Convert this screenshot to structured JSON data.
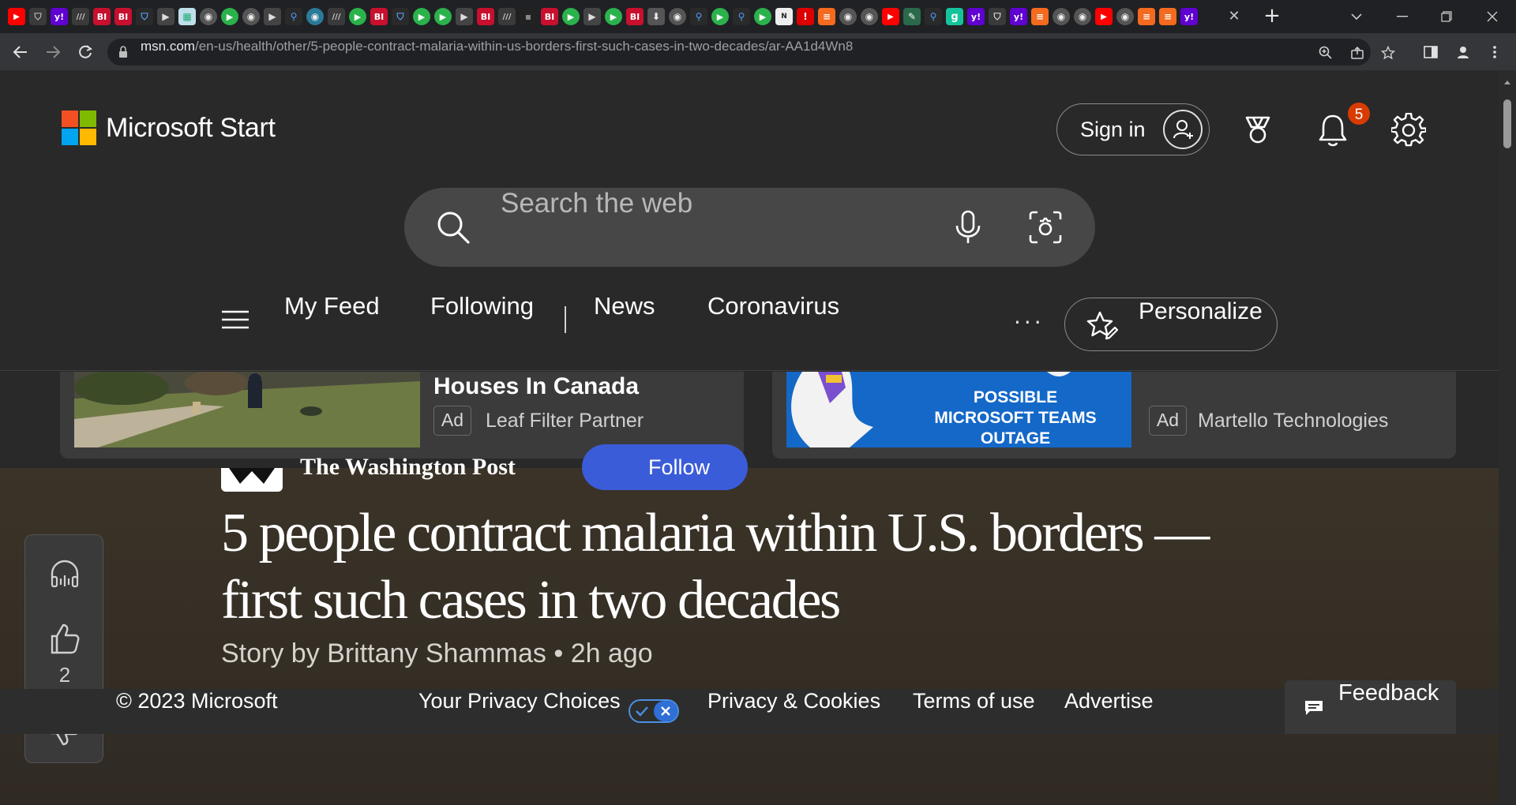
{
  "browser": {
    "url_host": "msn.com",
    "url_path": "/en-us/health/other/5-people-contract-malaria-within-us-borders-first-such-cases-in-two-decades/ar-AA1d4Wn8",
    "tab_close_glyph": "✕",
    "new_tab_glyph": "+"
  },
  "header": {
    "brand": "Microsoft Start",
    "sign_in": "Sign in",
    "notification_count": "5"
  },
  "search": {
    "placeholder": "Search the web"
  },
  "nav": {
    "items": [
      "My Feed",
      "Following",
      "News",
      "Coronavirus"
    ],
    "more": "···",
    "personalize": "Personalize"
  },
  "ads": [
    {
      "title": "Houses In Canada",
      "badge": "Ad",
      "source": "Leaf Filter Partner"
    },
    {
      "image_text": [
        "POSSIBLE",
        "MICROSOFT TEAMS",
        "OUTAGE"
      ],
      "badge": "Ad",
      "source": "Martello Technologies"
    }
  ],
  "article": {
    "publisher": "The Washington Post",
    "follow": "Follow",
    "headline": "5 people contract malaria within U.S. borders — first such cases in two decades",
    "byline": "Story by Brittany Shammas • 2h ago",
    "like_count": "2"
  },
  "footer": {
    "copyright": "© 2023 Microsoft",
    "privacy_choices": "Your Privacy Choices",
    "privacy_cookies": "Privacy & Cookies",
    "terms": "Terms of use",
    "advertise": "Advertise",
    "feedback": "Feedback"
  },
  "colors": {
    "ms_red": "#f25022",
    "ms_green": "#7fba00",
    "ms_blue": "#00a4ef",
    "ms_yellow": "#ffb900",
    "badge": "#d83b01",
    "follow": "#3b5cd9",
    "toggle": "#2f6fd6"
  },
  "icons": [
    "search-icon",
    "microphone-icon",
    "visual-search-icon",
    "rewards-medal-icon",
    "bell-icon",
    "gear-icon",
    "hamburger-icon",
    "star-pencil-icon",
    "headphones-icon",
    "thumbs-up-icon",
    "thumbs-down-icon",
    "feedback-icon"
  ]
}
